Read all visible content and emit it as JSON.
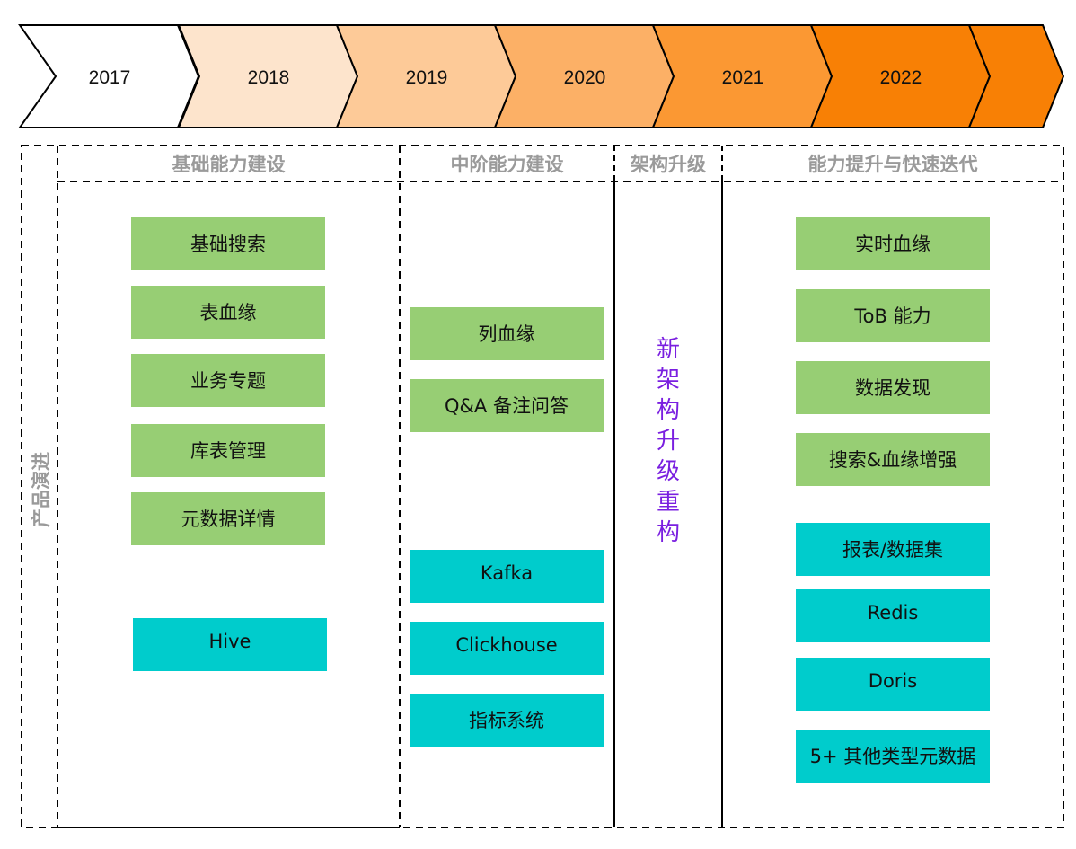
{
  "timeline": {
    "years": [
      {
        "label": "2017",
        "color": "#ffffff"
      },
      {
        "label": "2018",
        "color": "#fde4cc"
      },
      {
        "label": "2019",
        "color": "#fdca98"
      },
      {
        "label": "2020",
        "color": "#fcb066"
      },
      {
        "label": "2021",
        "color": "#fb9833"
      },
      {
        "label": "2022",
        "color": "#f88005"
      },
      {
        "label": "",
        "color": "#f88005"
      }
    ]
  },
  "side_label": "产品演进",
  "columns": [
    {
      "title": "基础能力建设"
    },
    {
      "title": "中阶能力建设"
    },
    {
      "title": "架构升级"
    },
    {
      "title": "能力提升与快速迭代"
    }
  ],
  "arch_upgrade_text": [
    "新",
    "架",
    "构",
    "升",
    "级",
    "重",
    "构"
  ],
  "colors": {
    "feature_green": "#97ce74",
    "datasource_teal": "#00cccc",
    "header_gray": "#9a9a9a",
    "arch_purple": "#7a1fe0"
  },
  "col1_items": {
    "features": [
      "基础搜索",
      "表血缘",
      "业务专题",
      "库表管理",
      "元数据详情"
    ],
    "datasources": [
      "Hive"
    ]
  },
  "col2_items": {
    "features": [
      "列血缘",
      "Q&A 备注问答"
    ],
    "datasources": [
      "Kafka",
      "Clickhouse",
      "指标系统"
    ]
  },
  "col4_items": {
    "features": [
      "实时血缘",
      "ToB 能力",
      "数据发现",
      "搜索&血缘增强"
    ],
    "datasources": [
      "报表/数据集",
      "Redis",
      "Doris",
      "5+ 其他类型元数据"
    ]
  }
}
